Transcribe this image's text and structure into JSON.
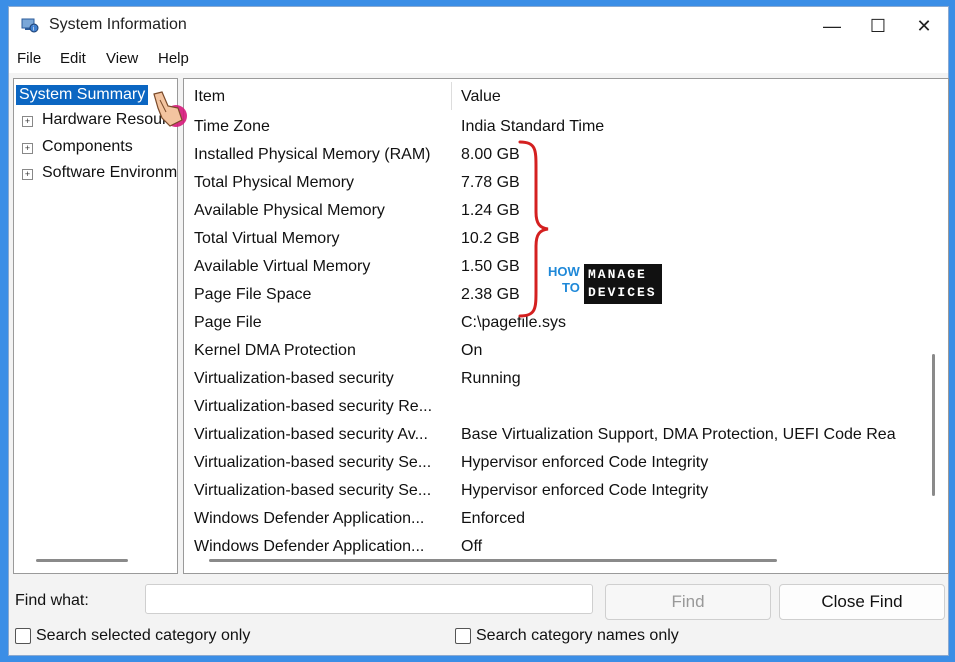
{
  "window": {
    "title": "System Information",
    "minimize": "—",
    "maximize": "☐",
    "close": "✕"
  },
  "menu": [
    "File",
    "Edit",
    "View",
    "Help"
  ],
  "tree": [
    {
      "label": "System Summary",
      "selected": true,
      "expandable": false
    },
    {
      "label": "Hardware Resources",
      "selected": false,
      "expandable": true
    },
    {
      "label": "Components",
      "selected": false,
      "expandable": true
    },
    {
      "label": "Software Environment",
      "selected": false,
      "expandable": true
    }
  ],
  "table": {
    "columns": [
      "Item",
      "Value"
    ],
    "rows": [
      {
        "item": "Time Zone",
        "value": "India Standard Time"
      },
      {
        "item": "Installed Physical Memory (RAM)",
        "value": "8.00 GB"
      },
      {
        "item": "Total Physical Memory",
        "value": "7.78 GB"
      },
      {
        "item": "Available Physical Memory",
        "value": "1.24 GB"
      },
      {
        "item": "Total Virtual Memory",
        "value": "10.2 GB"
      },
      {
        "item": "Available Virtual Memory",
        "value": "1.50 GB"
      },
      {
        "item": "Page File Space",
        "value": "2.38 GB"
      },
      {
        "item": "Page File",
        "value": "C:\\pagefile.sys"
      },
      {
        "item": "Kernel DMA Protection",
        "value": "On"
      },
      {
        "item": "Virtualization-based security",
        "value": "Running"
      },
      {
        "item": "Virtualization-based security Re...",
        "value": ""
      },
      {
        "item": "Virtualization-based security Av...",
        "value": "Base Virtualization Support, DMA Protection, UEFI Code Rea"
      },
      {
        "item": "Virtualization-based security Se...",
        "value": "Hypervisor enforced Code Integrity"
      },
      {
        "item": "Virtualization-based security Se...",
        "value": "Hypervisor enforced Code Integrity"
      },
      {
        "item": "Windows Defender Application...",
        "value": "Enforced"
      },
      {
        "item": "Windows Defender Application...",
        "value": "Off"
      }
    ]
  },
  "find": {
    "label": "Find what:",
    "value": "",
    "find_button": "Find",
    "close_find_button": "Close Find",
    "option_selected_category": "Search selected category only",
    "option_category_names": "Search category names only"
  },
  "watermark": {
    "how": "HOW",
    "to": "TO",
    "manage": "MANAGE",
    "devices": "DEVICES"
  },
  "colors": {
    "selection": "#0b66c2",
    "annotation_brace": "#d42020",
    "background": "#3b8ee6"
  }
}
